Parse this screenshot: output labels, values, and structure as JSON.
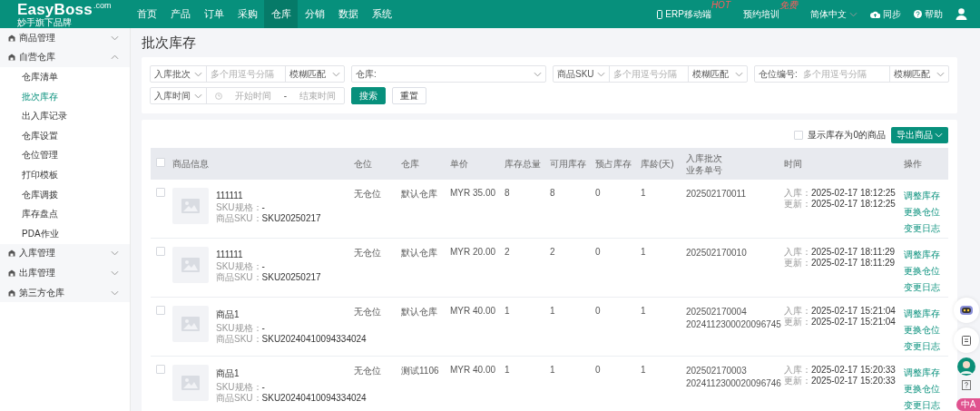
{
  "nav": {
    "logo": "EasyBoss",
    "logo_suffix": ".com",
    "tagline": "妙手旗下品牌",
    "items": [
      {
        "label": "首页",
        "selected": false
      },
      {
        "label": "产品",
        "selected": false
      },
      {
        "label": "订单",
        "selected": false
      },
      {
        "label": "采购",
        "selected": false
      },
      {
        "label": "仓库",
        "selected": true
      },
      {
        "label": "分销",
        "selected": false
      },
      {
        "label": "数据",
        "selected": false
      },
      {
        "label": "系统",
        "selected": false
      }
    ],
    "right": [
      {
        "kind": "mobile",
        "label": "ERP移动端",
        "badge": "HOT"
      },
      {
        "kind": "plain",
        "label": "预约培训",
        "badge": "免费"
      },
      {
        "kind": "language",
        "label": "简体中文"
      },
      {
        "kind": "sync",
        "label": "同步"
      },
      {
        "kind": "help",
        "label": "帮助"
      },
      {
        "kind": "user"
      }
    ]
  },
  "sidebar": [
    {
      "label": "商品管理",
      "expanded": false
    },
    {
      "label": "自营仓库",
      "expanded": true,
      "children": [
        {
          "label": "仓库清单",
          "selected": false
        },
        {
          "label": "批次库存",
          "selected": true
        },
        {
          "label": "出入库记录",
          "selected": false
        },
        {
          "label": "仓库设置",
          "selected": false
        },
        {
          "label": "仓位管理",
          "selected": false
        },
        {
          "label": "打印模板",
          "selected": false
        },
        {
          "label": "仓库调拨",
          "selected": false
        },
        {
          "label": "库存盘点",
          "selected": false
        },
        {
          "label": "PDA作业",
          "selected": false
        }
      ]
    },
    {
      "label": "入库管理",
      "expanded": false
    },
    {
      "label": "出库管理",
      "expanded": false
    },
    {
      "label": "第三方仓库",
      "expanded": false
    }
  ],
  "page_title": "批次库存",
  "filters": [
    [
      {
        "kind": "group",
        "parts": [
          {
            "kind": "select",
            "label": "入库批次"
          },
          {
            "kind": "input",
            "placeholder": "多个用逗号分隔"
          },
          {
            "kind": "match",
            "label": "模糊匹配"
          }
        ]
      },
      {
        "kind": "group",
        "parts": [
          {
            "kind": "wide-select",
            "label": "仓库:"
          }
        ]
      },
      {
        "kind": "group",
        "parts": [
          {
            "kind": "select",
            "label": "商品SKU"
          },
          {
            "kind": "input",
            "placeholder": "多个用逗号分隔"
          },
          {
            "kind": "match",
            "label": "模糊匹配"
          }
        ]
      },
      {
        "kind": "group",
        "parts": [
          {
            "kind": "prefix-input",
            "label": "仓位编号:",
            "placeholder": "多个用逗号分隔"
          },
          {
            "kind": "match",
            "label": "模糊匹配"
          }
        ]
      }
    ],
    [
      {
        "kind": "group",
        "parts": [
          {
            "kind": "select",
            "label": "入库时间"
          },
          {
            "kind": "date-range",
            "start": "开始时间",
            "separator": "-",
            "end": "结束时间"
          }
        ]
      },
      {
        "kind": "primary-button",
        "label": "搜索"
      },
      {
        "kind": "button",
        "label": "重置"
      }
    ]
  ],
  "toolbar": {
    "show_zero": {
      "label": "显示库存为0的商品",
      "checked": false
    },
    "export": "导出商品"
  },
  "table": {
    "select_all_checked": false,
    "columns": [
      [
        "商品信息"
      ],
      [
        "仓位"
      ],
      [
        "仓库"
      ],
      [
        "单价"
      ],
      [
        "库存总量"
      ],
      [
        "可用库存"
      ],
      [
        "预占库存"
      ],
      [
        "库龄(天)"
      ],
      [
        "入库批次",
        "业务单号"
      ],
      [
        "时间"
      ],
      [
        "操作"
      ]
    ],
    "rows": [
      {
        "checked": false,
        "name": "111111",
        "spec_label": "SKU规格：",
        "spec": "-",
        "sku_label": "商品SKU：",
        "sku": "SKU20250217",
        "location": "无仓位",
        "warehouse": "默认仓库",
        "price": "MYR 35.00",
        "total": "8",
        "available": "8",
        "reserved": "0",
        "age": "1",
        "batch": [
          "202502170011"
        ],
        "times": [
          {
            "label": "入库：",
            "value": "2025-02-17 18:12:25"
          },
          {
            "label": "更新：",
            "value": "2025-02-17 18:12:25"
          }
        ],
        "actions": [
          "调整库存",
          "更换仓位",
          "变更日志"
        ]
      },
      {
        "checked": false,
        "name": "111111",
        "spec_label": "SKU规格：",
        "spec": "-",
        "sku_label": "商品SKU：",
        "sku": "SKU20250217",
        "location": "无仓位",
        "warehouse": "默认仓库",
        "price": "MYR 20.00",
        "total": "2",
        "available": "2",
        "reserved": "0",
        "age": "1",
        "batch": [
          "202502170010"
        ],
        "times": [
          {
            "label": "入库：",
            "value": "2025-02-17 18:11:29"
          },
          {
            "label": "更新：",
            "value": "2025-02-17 18:11:29"
          }
        ],
        "actions": [
          "调整库存",
          "更换仓位",
          "变更日志"
        ]
      },
      {
        "checked": false,
        "name": "商品1",
        "spec_label": "SKU规格：",
        "spec": "-",
        "sku_label": "商品SKU：",
        "sku": "SKU20240410094334024",
        "location": "无仓位",
        "warehouse": "默认仓库",
        "price": "MYR 40.00",
        "total": "1",
        "available": "1",
        "reserved": "0",
        "age": "1",
        "batch": [
          "202502170004",
          "2024112300020096745"
        ],
        "times": [
          {
            "label": "入库：",
            "value": "2025-02-17 15:21:04"
          },
          {
            "label": "更新：",
            "value": "2025-02-17 15:21:04"
          }
        ],
        "actions": [
          "调整库存",
          "更换仓位",
          "变更日志"
        ]
      },
      {
        "checked": false,
        "name": "商品1",
        "spec_label": "SKU规格：",
        "spec": "-",
        "sku_label": "商品SKU：",
        "sku": "SKU20240410094334024",
        "location": "无仓位",
        "warehouse": "测试1106",
        "price": "MYR 40.00",
        "total": "1",
        "available": "1",
        "reserved": "0",
        "age": "1",
        "batch": [
          "202502170003",
          "2024112300020096746"
        ],
        "times": [
          {
            "label": "入库：",
            "value": "2025-02-17 15:20:33"
          },
          {
            "label": "更新：",
            "value": "2025-02-17 15:20:33"
          }
        ],
        "actions": [
          "调整库存",
          "更换仓位",
          "变更日志"
        ]
      }
    ]
  },
  "float_badge": "中A"
}
